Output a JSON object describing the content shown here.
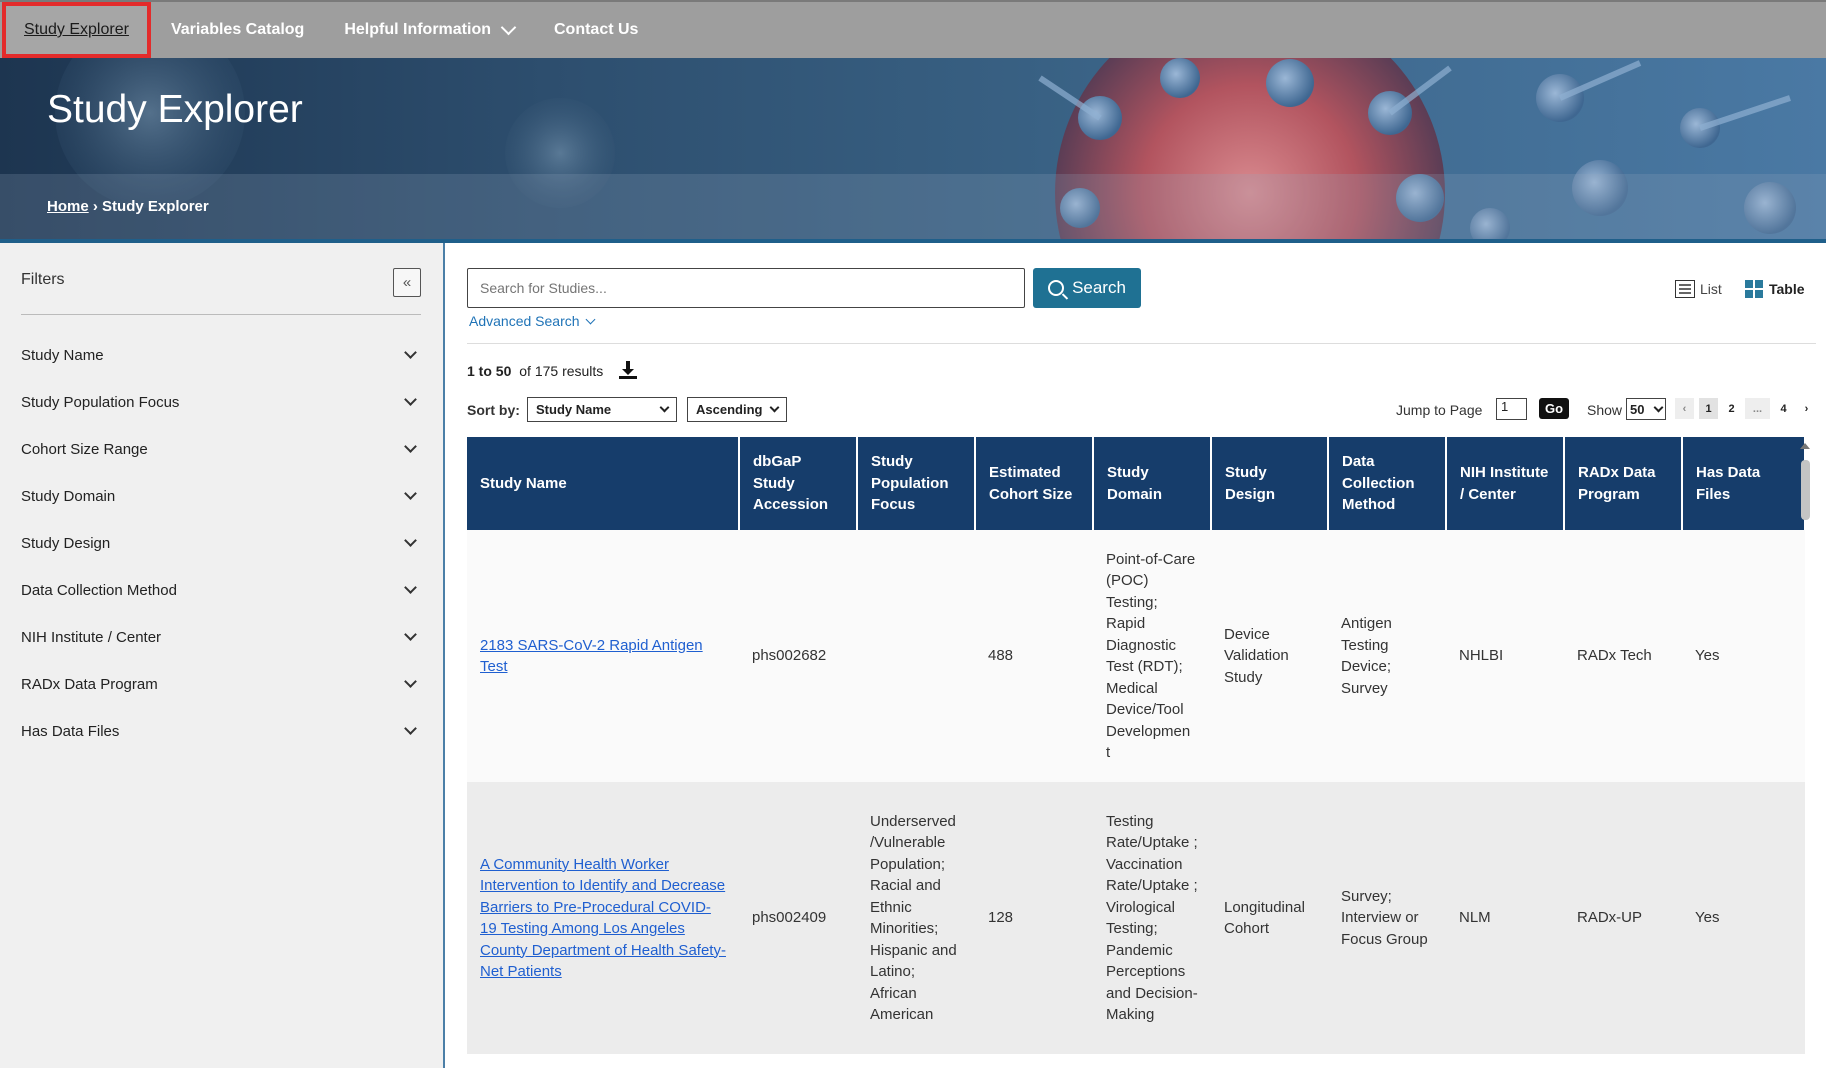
{
  "nav": {
    "items": [
      "Study Explorer",
      "Variables Catalog",
      "Helpful Information",
      "Contact Us"
    ]
  },
  "hero": {
    "title": "Study Explorer",
    "breadcrumb_home": "Home",
    "breadcrumb_sep": "›",
    "breadcrumb_current": "Study Explorer"
  },
  "sidebar": {
    "title": "Filters",
    "collapse_icon": "«",
    "filters": [
      "Study Name",
      "Study Population Focus",
      "Cohort Size Range",
      "Study Domain",
      "Study Design",
      "Data Collection Method",
      "NIH Institute / Center",
      "RADx Data Program",
      "Has Data Files"
    ]
  },
  "search": {
    "placeholder": "Search for Studies...",
    "button_label": "Search",
    "advanced_label": "Advanced Search"
  },
  "view": {
    "list_label": "List",
    "table_label": "Table"
  },
  "results": {
    "range": "1 to 50",
    "total_text": "of 175 results"
  },
  "sort": {
    "label": "Sort by:",
    "field": "Study Name",
    "order": "Ascending"
  },
  "pager": {
    "jump_label": "Jump to Page",
    "jump_value": "1",
    "go_label": "Go",
    "show_label": "Show",
    "show_value": "50",
    "prev": "‹",
    "pages": [
      "1",
      "2",
      "...",
      "4"
    ],
    "next": "›"
  },
  "table": {
    "headers": [
      "Study Name",
      "dbGaP Study Accession",
      "Study Population Focus",
      "Estimated Cohort Size",
      "Study Domain",
      "Study Design",
      "Data Collection Method",
      "NIH Institute / Center",
      "RADx Data Program",
      "Has Data Files"
    ],
    "rows": [
      [
        "2183 SARS-CoV-2 Rapid Antigen Test",
        "phs002682",
        "",
        "488",
        "Point-of-Care (POC) Testing; Rapid Diagnostic Test (RDT); Medical Device/Tool Developmen t",
        "Device Validation Study",
        "Antigen Testing Device; Survey",
        "NHLBI",
        "RADx Tech",
        "Yes"
      ],
      [
        "A Community Health Worker Intervention to Identify and Decrease Barriers to Pre-Procedural COVID-19 Testing Among Los Angeles County Department of Health Safety-Net Patients",
        "phs002409",
        "Underserved /Vulnerable Population; Racial and Ethnic Minorities; Hispanic and Latino; African American",
        "128",
        "Testing Rate/Uptake ; Vaccination Rate/Uptake ; Virological Testing; Pandemic Perceptions and Decision-Making",
        "Longitudinal Cohort",
        "Survey; Interview or Focus Group",
        "NLM",
        "RADx-UP",
        "Yes"
      ]
    ]
  },
  "colors": {
    "nav_bg": "#9e9e9e",
    "header_bg": "#163d6b",
    "search_btn": "#1f7193",
    "link": "#1f5fd0",
    "active_outline": "#e32b2b"
  }
}
